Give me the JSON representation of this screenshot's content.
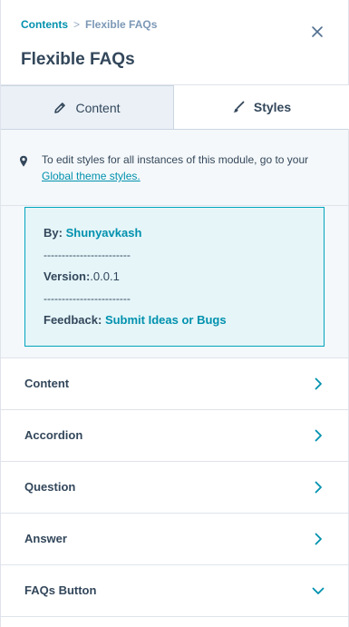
{
  "breadcrumb": {
    "parent": "Contents",
    "separator": ">",
    "current": "Flexible FAQs"
  },
  "page_title": "Flexible FAQs",
  "tabs": [
    {
      "label": "Content",
      "icon": "pencil-icon",
      "active": false
    },
    {
      "label": "Styles",
      "icon": "brush-icon",
      "active": true
    }
  ],
  "notice": {
    "icon": "map-pin-icon",
    "text": "To edit styles for all instances of this module, go to your ",
    "link": "Global theme styles."
  },
  "info": {
    "by_label": "By:",
    "by_value": "Shunyavkash",
    "divider": "------------------------",
    "version_label": "Version:",
    "version_value": ".0.0.1",
    "feedback_label": "Feedback:",
    "feedback_value": "Submit Ideas or Bugs"
  },
  "sections": [
    {
      "label": "Content",
      "icon": "chevron-right-icon"
    },
    {
      "label": "Accordion",
      "icon": "chevron-right-icon"
    },
    {
      "label": "Question",
      "icon": "chevron-right-icon"
    },
    {
      "label": "Answer",
      "icon": "chevron-right-icon"
    },
    {
      "label": "FAQs Button",
      "icon": "chevron-down-icon"
    }
  ],
  "colors": {
    "accent": "#0091ae",
    "text": "#33475b",
    "info_bg": "#e5f5f8",
    "info_border": "#00a4bd"
  }
}
